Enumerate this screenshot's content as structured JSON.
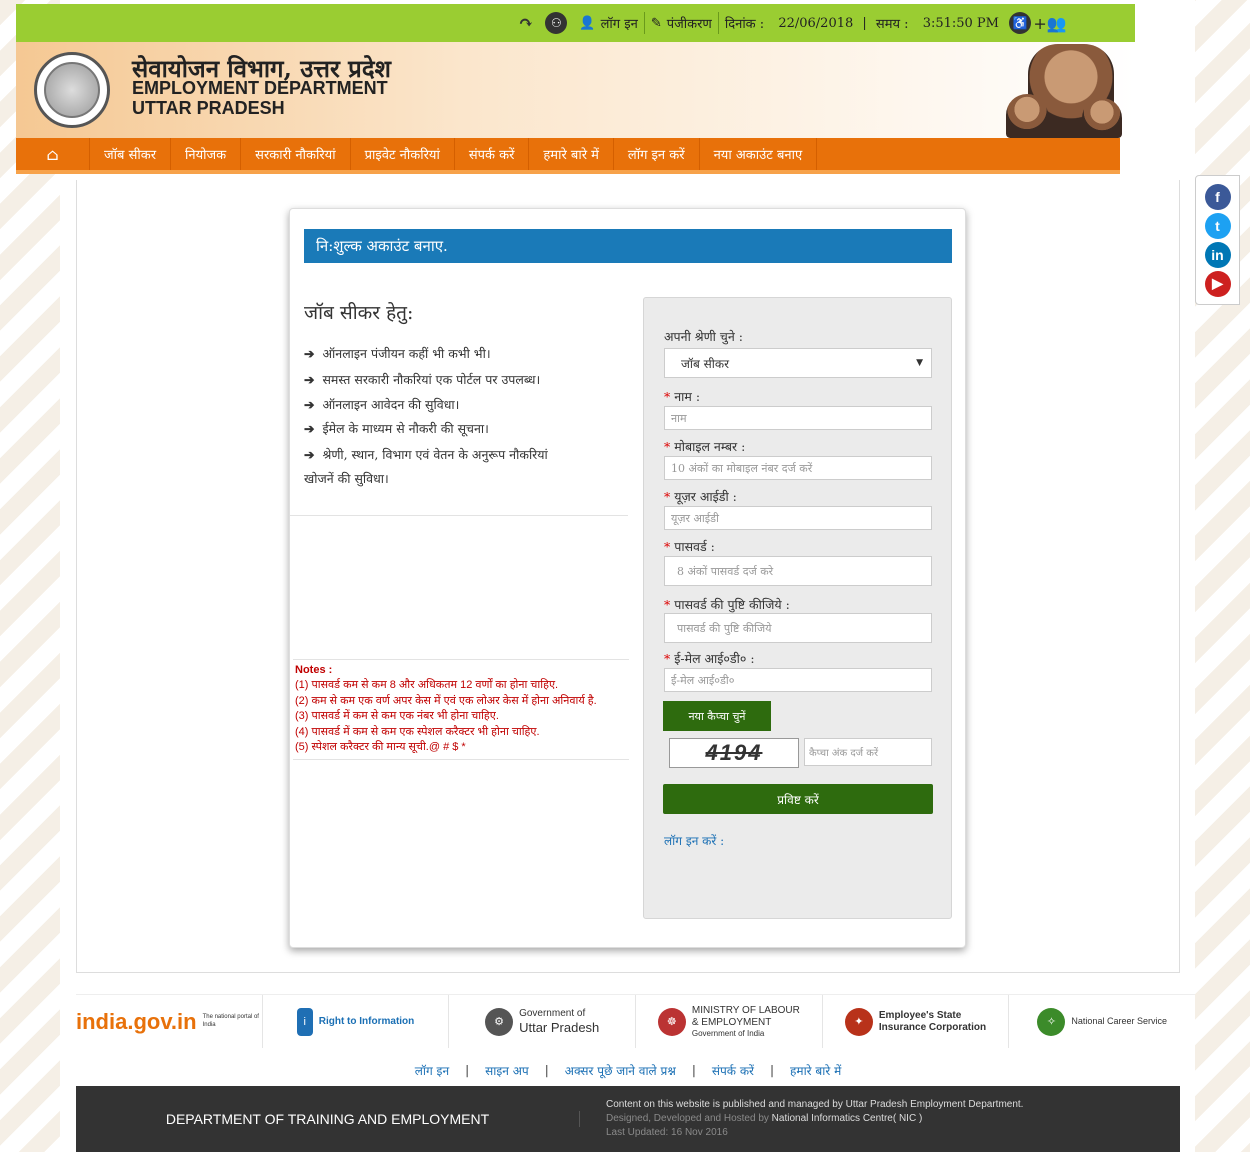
{
  "topbar": {
    "login": "लॉग इन",
    "register": "पंजीकरण",
    "date_label": "दिनांक :",
    "date_value": "22/06/2018",
    "time_label": "समय :",
    "time_value": "3:51:50 PM"
  },
  "header": {
    "title_hi": "सेवायोजन विभाग, उत्तर प्रदेश",
    "title_en1": "EMPLOYMENT DEPARTMENT",
    "title_en2": "UTTAR PRADESH"
  },
  "nav": {
    "items": [
      "जॉब सीकर",
      "नियोजक",
      "सरकारी नौकरियां",
      "प्राइवेट नौकरियां",
      "संपर्क करें",
      "हमारे बारे में",
      "लॉग इन करें",
      "नया अकाउंट बनाए"
    ]
  },
  "card": {
    "heading": "नि:शुल्क अकाउंट बनाए.",
    "left_title": "जॉब सीकर हेतु:",
    "features": [
      "ऑनलाइन पंजीयन कहीं भी कभी भी।",
      "समस्त सरकारी नौकरियां एक पोर्टल पर उपलब्ध।",
      "ऑनलाइन आवेदन की सुविधा।",
      "ईमेल के माध्यम से नौकरी की सूचना।",
      "श्रेणी, स्थान, विभाग एवं वेतन के अनुरूप नौकरियां",
      "खोजनें की सुविधा।"
    ],
    "notes_title": "Notes :",
    "notes": [
      "(1) पासवर्ड कम से कम 8 और अधिकतम 12 वर्णों का होना चाहिए.",
      "(2) कम से कम एक वर्ण अपर केस में एवं एक लोअर केस में होना अनिवार्य है.",
      "(3) पासवर्ड में कम से कम एक नंबर भी होना चाहिए.",
      "(4) पासवर्ड में कम से कम एक स्पेशल करैक्टर भी होना चाहिए.",
      "(5) स्पेशल करैक्टर की मान्य सूची.@ # $ *"
    ]
  },
  "form": {
    "category_label": "अपनी श्रेणी चुने :",
    "category_value": "जॉब सीकर",
    "name_label": "नाम :",
    "name_placeholder": "नाम",
    "mobile_label": "मोबाइल नम्बर :",
    "mobile_placeholder": "10 अंकों का मोबाइल नंबर दर्ज करें",
    "userid_label": "यूज़र आईडी :",
    "userid_placeholder": "यूज़र आईडी",
    "password_label": "पासवर्ड :",
    "password_placeholder": "8 अंकों पासवर्ड दर्ज करे",
    "confirm_label": "पासवर्ड की पुष्टि कीजिये :",
    "confirm_placeholder": "पासवर्ड की पुष्टि कीजिये",
    "email_label": "ई-मेल आई०डी० :",
    "email_placeholder": "ई-मेल आई०डी०",
    "captcha_button": "नया कैप्चा चुनें",
    "captcha_text": "4194",
    "captcha_placeholder": "कैप्चा अंक दर्ज करें",
    "submit": "प्रविष्ट करें",
    "login_link": "लॉग इन करें :"
  },
  "footer_logos": [
    {
      "name": "india.gov.in",
      "sub": "The national portal of India"
    },
    {
      "name": "Right to Information",
      "sub": ""
    },
    {
      "name": "Government of",
      "sub": "Uttar Pradesh"
    },
    {
      "name": "MINISTRY OF LABOUR",
      "sub": "& EMPLOYMENT",
      "sub2": "Government of India"
    },
    {
      "name": "Employee's State",
      "sub": "Insurance Corporation"
    },
    {
      "name": "National Career Service",
      "sub": ""
    }
  ],
  "footer_links": [
    "लॉग इन",
    "साइन अप",
    "अक्सर पूछे जाने वाले प्रश्न",
    "संपर्क करें",
    "हमारे बारे में"
  ],
  "footer": {
    "title": "DEPARTMENT OF TRAINING AND EMPLOYMENT",
    "line1": "Content on this website is published and managed by Uttar Pradesh Employment Department.",
    "line2_a": "Designed, Developed and Hosted by",
    "line2_b": "National Informatics Centre( NIC )",
    "line3": "Last Updated: 16 Nov 2016"
  },
  "colors": {
    "topbar": "#9acd32",
    "nav": "#e8710a",
    "card_heading": "#1a7ab8",
    "button": "#2e6b0e",
    "notes": "#c00000"
  }
}
